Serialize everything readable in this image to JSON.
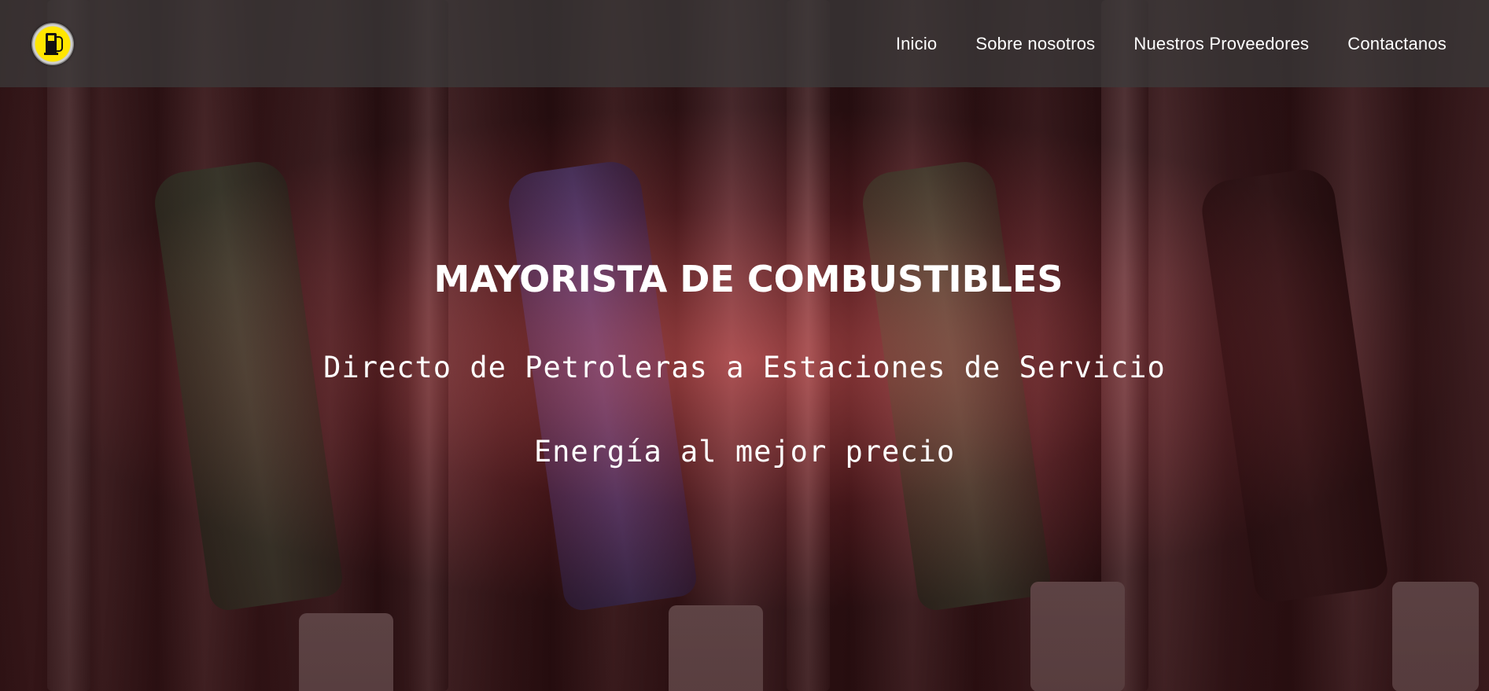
{
  "brand": {
    "logo_icon": "fuel-pump-icon",
    "logo_colors": {
      "fill": "#ffe600",
      "symbol": "#111111",
      "ring": "#cfcfcf"
    }
  },
  "nav": {
    "items": [
      {
        "label": "Inicio"
      },
      {
        "label": "Sobre nosotros"
      },
      {
        "label": "Nuestros Proveedores"
      },
      {
        "label": "Contactanos"
      }
    ]
  },
  "hero": {
    "title": "MAYORISTA DE COMBUSTIBLES",
    "subtitle": "Directo de Petroleras a Estaciones de Servicio",
    "tagline": "Energía al mejor precio"
  },
  "colors": {
    "navbar_bg": "#3c3c3c",
    "overlay_tint": "#e65a5a",
    "text": "#ffffff"
  }
}
